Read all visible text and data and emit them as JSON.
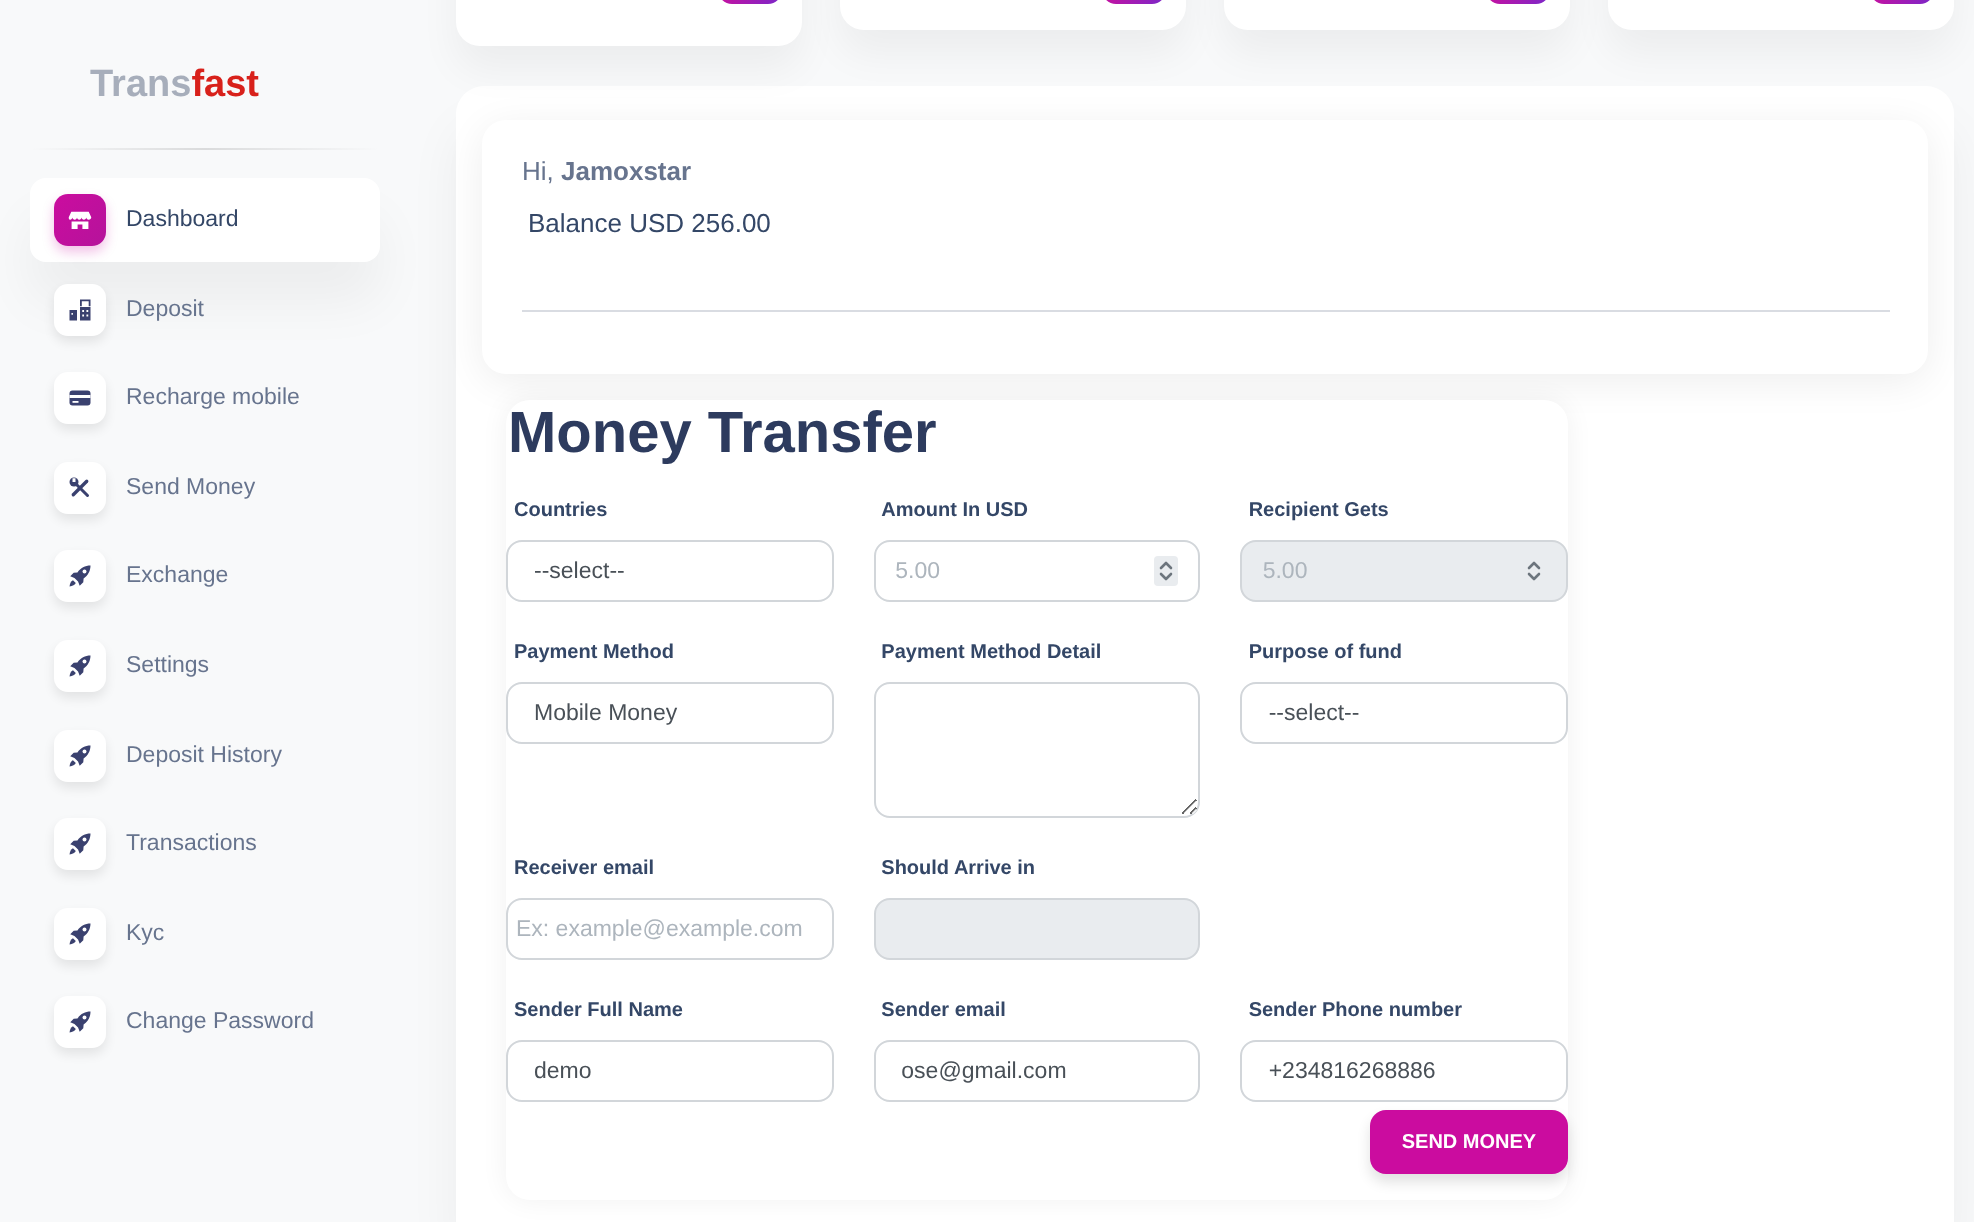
{
  "sidebar": {
    "logo": {
      "part_1": "Trans",
      "part_2": "fast"
    },
    "items": [
      {
        "label": "Dashboard",
        "selected": true
      },
      {
        "label": "Deposit",
        "selected": false
      },
      {
        "label": "Recharge mobile",
        "selected": false
      },
      {
        "label": "Send Money",
        "selected": false
      },
      {
        "label": "Exchange",
        "selected": false
      },
      {
        "label": "Settings",
        "selected": false
      },
      {
        "label": "Deposit History",
        "selected": false
      },
      {
        "label": "Transactions",
        "selected": false
      },
      {
        "label": "Kyc",
        "selected": false
      },
      {
        "label": "Change Password",
        "selected": false
      }
    ]
  },
  "welcome": {
    "greeting": "Hi, **Jamoxstar**",
    "balance": "Balance USD 256.00"
  },
  "transfer": {
    "title": "Money Transfer",
    "rows": [
      [
        {
          "label": "Countries",
          "kind": "input",
          "value": "--select--",
          "disabled": false
        },
        {
          "label": "Amount In USD",
          "kind": "number",
          "placeholder": "5.00",
          "disabled": false
        },
        {
          "label": "Recipient Gets",
          "kind": "number",
          "placeholder": "5.00",
          "disabled": true
        }
      ],
      [
        {
          "label": "Payment Method",
          "kind": "input",
          "value": "Mobile Money",
          "disabled": false
        },
        {
          "label": "Payment Method Detail",
          "kind": "textarea",
          "disabled": false
        },
        {
          "label": "Purpose of fund",
          "kind": "input",
          "value": "--select--",
          "disabled": false
        }
      ],
      [
        {
          "label": "Receiver email",
          "kind": "input",
          "placeholder": "Ex: example@example.com",
          "disabled": false
        },
        {
          "label": "Should Arrive in",
          "kind": "input",
          "disabled": true
        }
      ],
      [
        {
          "label": "Sender Full Name",
          "kind": "input",
          "value": "demo",
          "disabled": false
        },
        {
          "label": "Sender email",
          "kind": "input",
          "value": "ose@gmail.com",
          "disabled": false
        },
        {
          "label": "Sender Phone number",
          "kind": "input",
          "value": "+234816268886",
          "disabled": false
        }
      ]
    ],
    "submit": "SEND MONEY"
  }
}
